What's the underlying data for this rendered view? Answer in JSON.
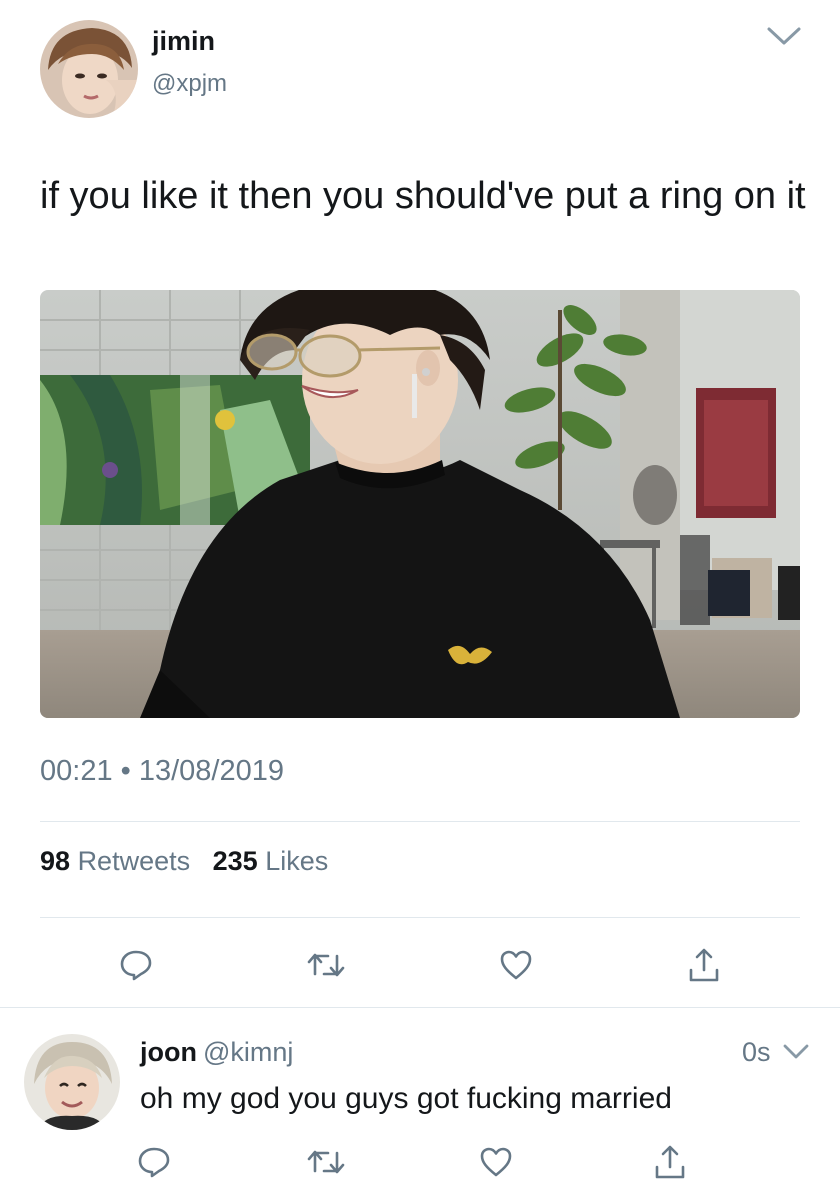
{
  "tweet": {
    "author": {
      "name": "jimin",
      "handle": "@xpjm"
    },
    "text": "if you like it then you should've put a ring on it",
    "time": "00:21",
    "separator": "•",
    "date": "13/08/2019",
    "retweets_count": "98",
    "retweets_label": "Retweets",
    "likes_count": "235",
    "likes_label": "Likes",
    "actions": [
      "reply-icon",
      "retweet-icon",
      "like-icon",
      "share-icon"
    ]
  },
  "reply": {
    "author": {
      "name": "joon",
      "handle": "@kimnj"
    },
    "time": "0s",
    "text": "oh my god you guys got fucking married",
    "actions": [
      "reply-icon",
      "retweet-icon",
      "like-icon",
      "share-icon"
    ]
  },
  "colors": {
    "text_primary": "#14171a",
    "text_secondary": "#657786",
    "divider": "#e1e8ed"
  }
}
